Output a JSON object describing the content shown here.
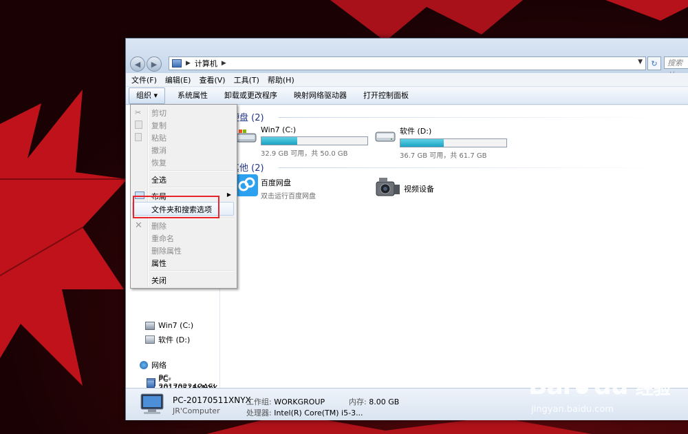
{
  "address": {
    "crumb": "计算机",
    "search_placeholder": "搜索 计..."
  },
  "menubar": [
    "文件(F)",
    "编辑(E)",
    "查看(V)",
    "工具(T)",
    "帮助(H)"
  ],
  "toolbar": {
    "organize": "组织 ▾",
    "items": [
      "系统属性",
      "卸载或更改程序",
      "映射网络驱动器",
      "打开控制面板"
    ]
  },
  "groups": {
    "hard_disk": "硬盘 (2)",
    "other": "其他 (2)"
  },
  "drives": [
    {
      "name": "Win7 (C:)",
      "usage": "32.9 GB 可用，共 50.0 GB",
      "used_fraction": 0.34
    },
    {
      "name": "软件 (D:)",
      "usage": "36.7 GB 可用，共 61.7 GB",
      "used_fraction": 0.41
    }
  ],
  "others": [
    {
      "name": "百度网盘",
      "sub": "双击运行百度网盘"
    },
    {
      "name": "视频设备",
      "sub": ""
    }
  ],
  "nav": {
    "drive_c": "Win7 (C:)",
    "drive_d": "软件 (D:)",
    "network": "网络",
    "pc1": "PC-20170224QASI",
    "pc2": "PC-20170511XNYX"
  },
  "context_menu": {
    "cut": "剪切",
    "copy": "复制",
    "paste": "粘贴",
    "undo": "撤消",
    "redo": "恢复",
    "select_all": "全选",
    "layout": "布局",
    "folder_options": "文件夹和搜索选项",
    "delete": "删除",
    "rename": "重命名",
    "remove_props": "删除属性",
    "properties": "属性",
    "close": "关闭"
  },
  "status": {
    "pc_name": "PC-20170511XNYX",
    "workgroup_label": "工作组:",
    "workgroup": "WORKGROUP",
    "memory_label": "内存:",
    "memory": "8.00 GB",
    "description": "JR'Computer",
    "cpu_label": "处理器:",
    "cpu": "Intel(R) Core(TM) i5-3..."
  },
  "watermark": {
    "brand_a": "Bai",
    "brand_b": "du",
    "brand_cn": "经验",
    "url": "jingyan.baidu.com"
  },
  "colors": {
    "accent_blue": "#1e3287",
    "bar_fill": "#1ba3c4",
    "highlight_box": "#e8232a"
  }
}
